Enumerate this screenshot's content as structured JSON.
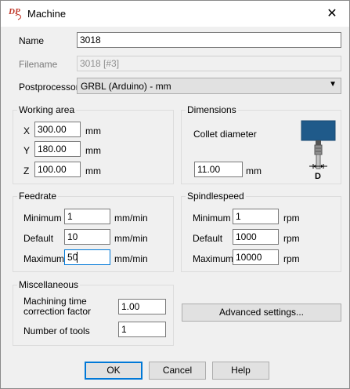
{
  "window": {
    "title": "Machine",
    "close_glyph": "✕",
    "logo_text": "DP"
  },
  "general": {
    "name_label": "Name",
    "name_value": "3018",
    "filename_label": "Filename",
    "filename_value": "3018 [#3]",
    "postprocessor_label": "Postprocessor",
    "postprocessor_value": "GRBL (Arduino) - mm"
  },
  "working_area": {
    "title": "Working area",
    "x_label": "X",
    "x_value": "300.00",
    "x_unit": "mm",
    "y_label": "Y",
    "y_value": "180.00",
    "y_unit": "mm",
    "z_label": "Z",
    "z_value": "100.00",
    "z_unit": "mm"
  },
  "dimensions": {
    "title": "Dimensions",
    "collet_label": "Collet diameter",
    "collet_value": "11.00",
    "collet_unit": "mm",
    "diagram_letter": "D"
  },
  "feedrate": {
    "title": "Feedrate",
    "min_label": "Minimum",
    "min_value": "1",
    "min_unit": "mm/min",
    "def_label": "Default",
    "def_value": "10",
    "def_unit": "mm/min",
    "max_label": "Maximum",
    "max_value": "50",
    "max_unit": "mm/min"
  },
  "spindle": {
    "title": "Spindlespeed",
    "min_label": "Minimum",
    "min_value": "1",
    "min_unit": "rpm",
    "def_label": "Default",
    "def_value": "1000",
    "def_unit": "rpm",
    "max_label": "Maximum",
    "max_value": "10000",
    "max_unit": "rpm"
  },
  "misc": {
    "title": "Miscellaneous",
    "mtcf_label_line1": "Machining time",
    "mtcf_label_line2": "correction factor",
    "mtcf_value": "1.00",
    "tools_label": "Number of tools",
    "tools_value": "1"
  },
  "buttons": {
    "advanced": "Advanced settings...",
    "ok": "OK",
    "cancel": "Cancel",
    "help": "Help"
  },
  "colors": {
    "accent": "#0078d7",
    "collet_blue": "#1f5a8a",
    "logo_red": "#c0392b"
  }
}
